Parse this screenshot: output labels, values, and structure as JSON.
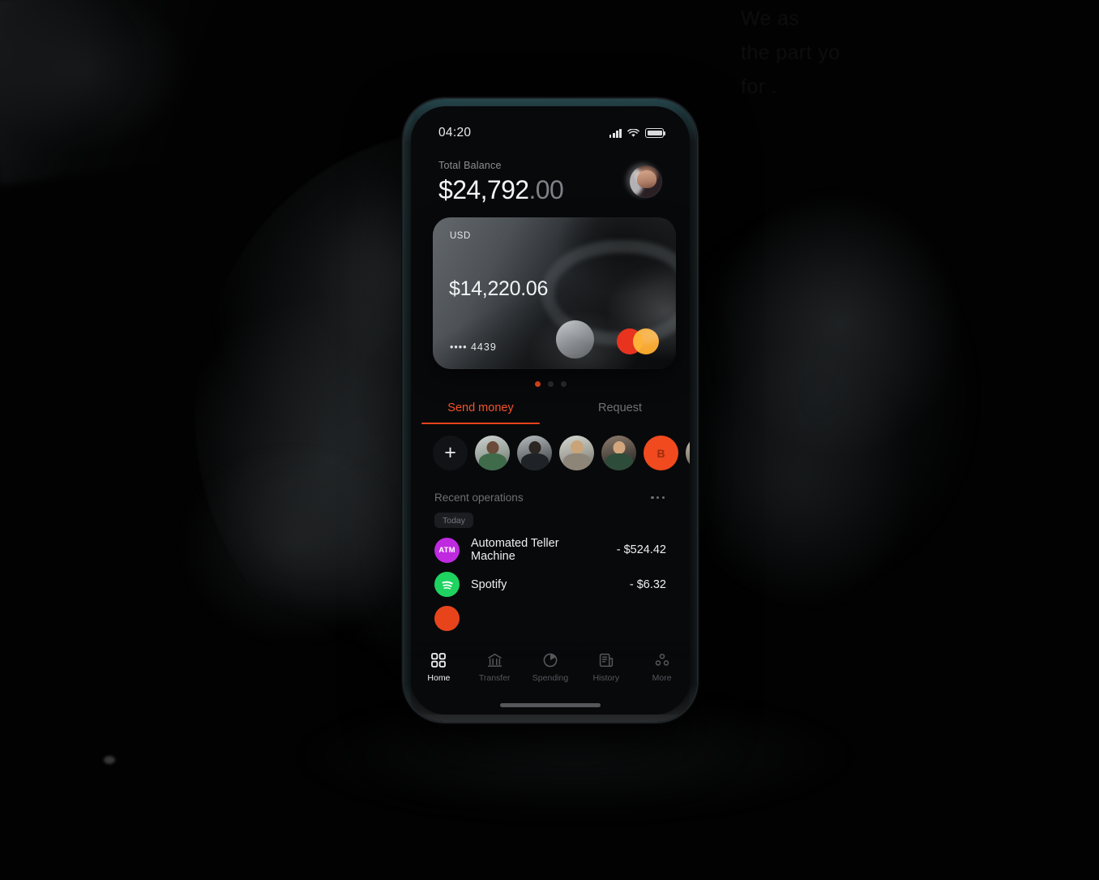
{
  "background": {
    "ghost_headline": "We                                 as\n                                the part  yo\nfor                      ."
  },
  "phone": {
    "status_bar": {
      "time": "04:20",
      "icons": [
        "signal-icon",
        "wifi-icon",
        "battery-icon"
      ]
    },
    "header": {
      "balance_label": "Total Balance",
      "balance_whole": "$24,792",
      "balance_cents": ".00",
      "avatar_name": "profile-avatar"
    },
    "card": {
      "currency": "USD",
      "amount": "$14,220.06",
      "masked_number": "•••• 4439",
      "network": "mastercard",
      "pager": {
        "count": 3,
        "active_index": 0,
        "active_color": "#f0491e"
      }
    },
    "tabs": [
      {
        "label": "Send money",
        "active": true
      },
      {
        "label": "Request",
        "active": false
      }
    ],
    "contacts": {
      "add_label": "+",
      "items": [
        {
          "name": "contact-avatar-1",
          "type": "photo"
        },
        {
          "name": "contact-avatar-2",
          "type": "photo"
        },
        {
          "name": "contact-avatar-3",
          "type": "photo"
        },
        {
          "name": "contact-avatar-4",
          "type": "photo"
        },
        {
          "name": "contact-initial-b",
          "type": "initial",
          "label": "B",
          "color": "#f04a1e"
        },
        {
          "name": "contact-avatar-5",
          "type": "photo"
        }
      ]
    },
    "recent_operations": {
      "title": "Recent operations",
      "more_icon": "ellipsis-icon",
      "day_chip": "Today",
      "rows": [
        {
          "icon": "atm-icon",
          "icon_label": "ATM",
          "icon_color": "#bf2ae0",
          "name": "Automated Teller Machine",
          "amount": "- $524.42"
        },
        {
          "icon": "spotify-icon",
          "icon_label": "",
          "icon_color": "#1ed35f",
          "name": "Spotify",
          "amount": "- $6.32"
        },
        {
          "icon": "partial-icon",
          "icon_label": "",
          "icon_color": "#e8441c",
          "name": "",
          "amount": ""
        }
      ]
    },
    "tabbar": [
      {
        "label": "Home",
        "icon": "grid-icon",
        "active": true
      },
      {
        "label": "Transfer",
        "icon": "bank-icon",
        "active": false
      },
      {
        "label": "Spending",
        "icon": "pie-chart-icon",
        "active": false
      },
      {
        "label": "History",
        "icon": "receipt-icon",
        "active": false
      },
      {
        "label": "More",
        "icon": "dots-cluster-icon",
        "active": false
      }
    ]
  }
}
